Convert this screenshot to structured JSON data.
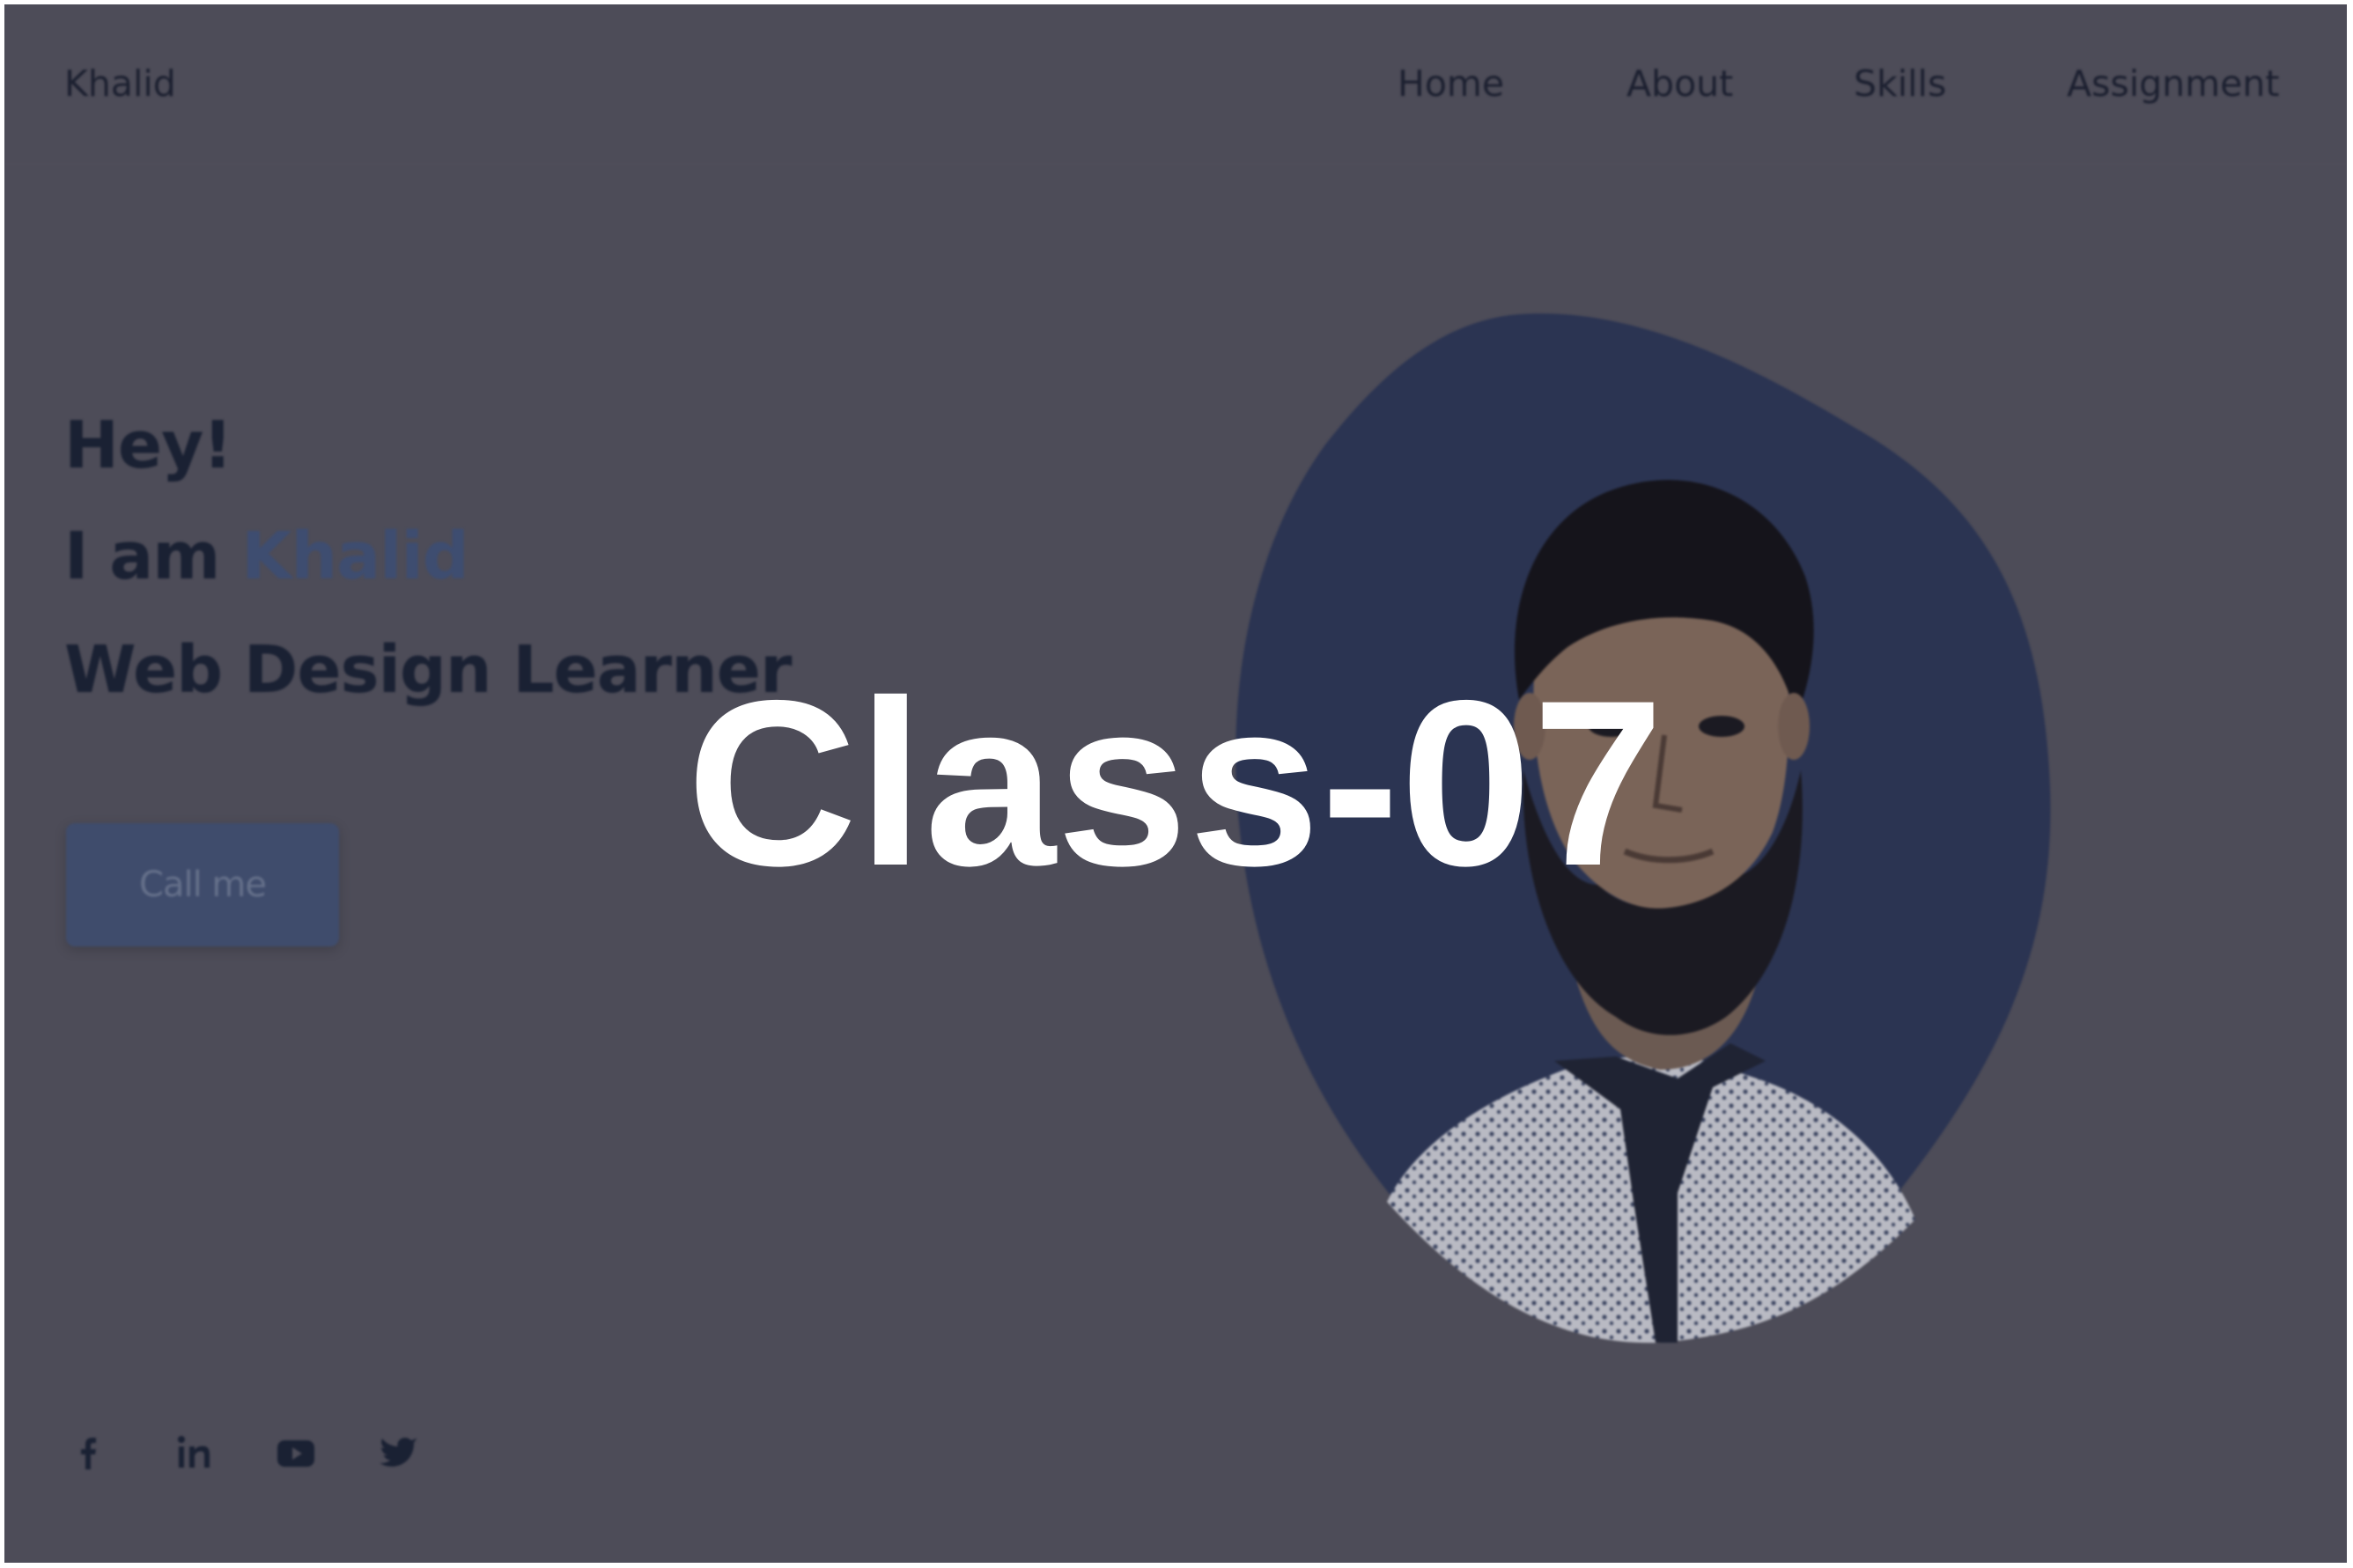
{
  "site": {
    "logo": "Khalid",
    "nav": [
      "Home",
      "About",
      "Skills",
      "Assignment"
    ],
    "hero": {
      "greeting": "Hey!",
      "intro_prefix": "I am ",
      "intro_name": "Khalid",
      "role": "Web Design Learner",
      "cta_label": "Call me"
    },
    "social_icons": [
      "facebook-icon",
      "linkedin-icon",
      "youtube-icon",
      "twitter-icon"
    ]
  },
  "overlay": {
    "title": "Class-07"
  },
  "colors": {
    "page_background": "#4d4c58",
    "text_dark": "#1a2133",
    "accent": "#3e4d70",
    "blob": "#2b3452",
    "overlay_text": "#ffffff"
  }
}
